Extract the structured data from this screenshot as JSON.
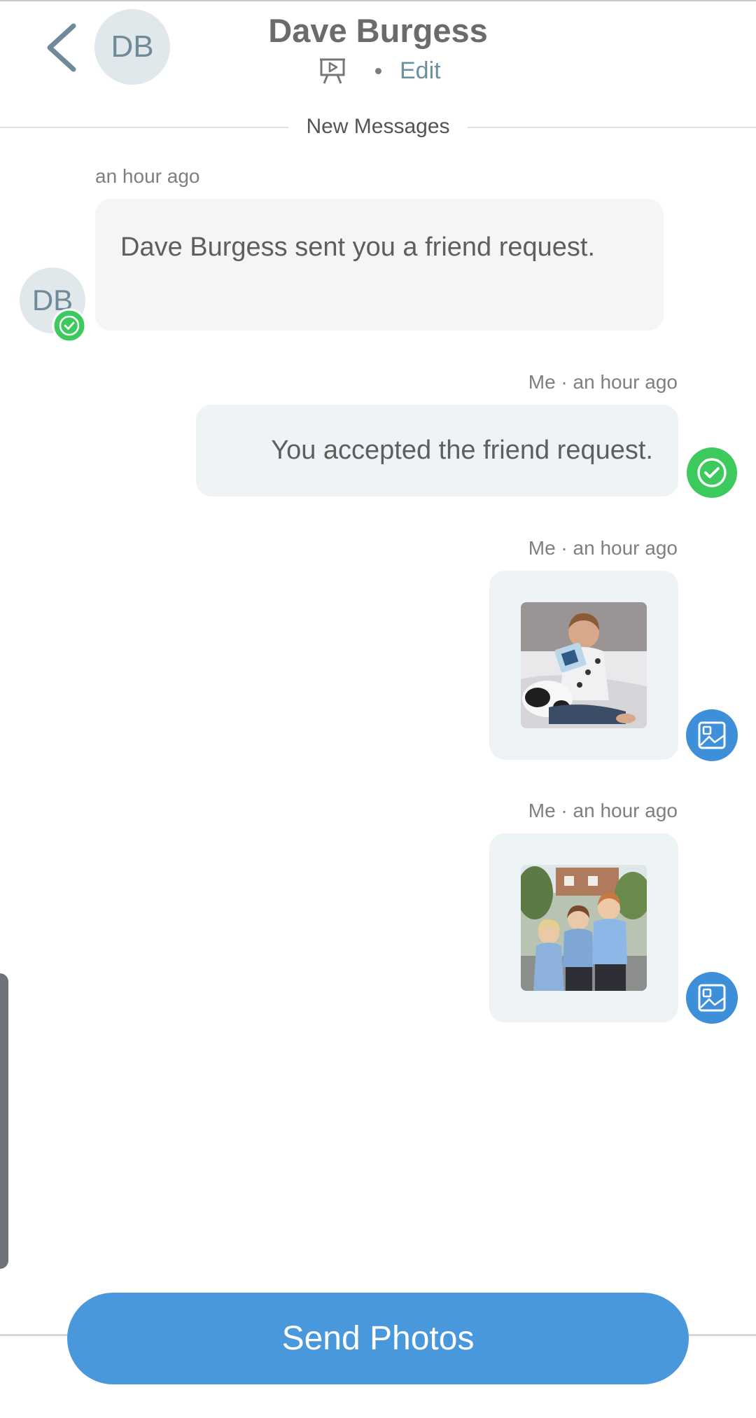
{
  "header": {
    "avatar_initials": "DB",
    "contact_name": "Dave Burgess",
    "edit_label": "Edit"
  },
  "divider_label": "New Messages",
  "messages": [
    {
      "direction": "incoming",
      "timestamp": "an hour ago",
      "text": "Dave Burgess sent you a friend request.",
      "avatar_initials": "DB"
    },
    {
      "direction": "outgoing",
      "timestamp": "Me · an hour ago",
      "text": "You accepted the friend request."
    },
    {
      "direction": "outgoing",
      "timestamp": "Me · an hour ago",
      "type": "photo"
    },
    {
      "direction": "outgoing",
      "timestamp": "Me · an hour ago",
      "type": "photo"
    }
  ],
  "send_button_label": "Send Photos",
  "colors": {
    "accent_blue": "#4a98dc",
    "check_green": "#3cc95e",
    "avatar_bg": "#e1e8ec",
    "outgoing_bubble": "#eef4f6",
    "incoming_bubble": "#f5f5f5"
  },
  "icons": {
    "back": "chevron-left-icon",
    "slideshow": "slideshow-icon",
    "delivered": "check-circle-icon",
    "photo": "image-icon"
  }
}
